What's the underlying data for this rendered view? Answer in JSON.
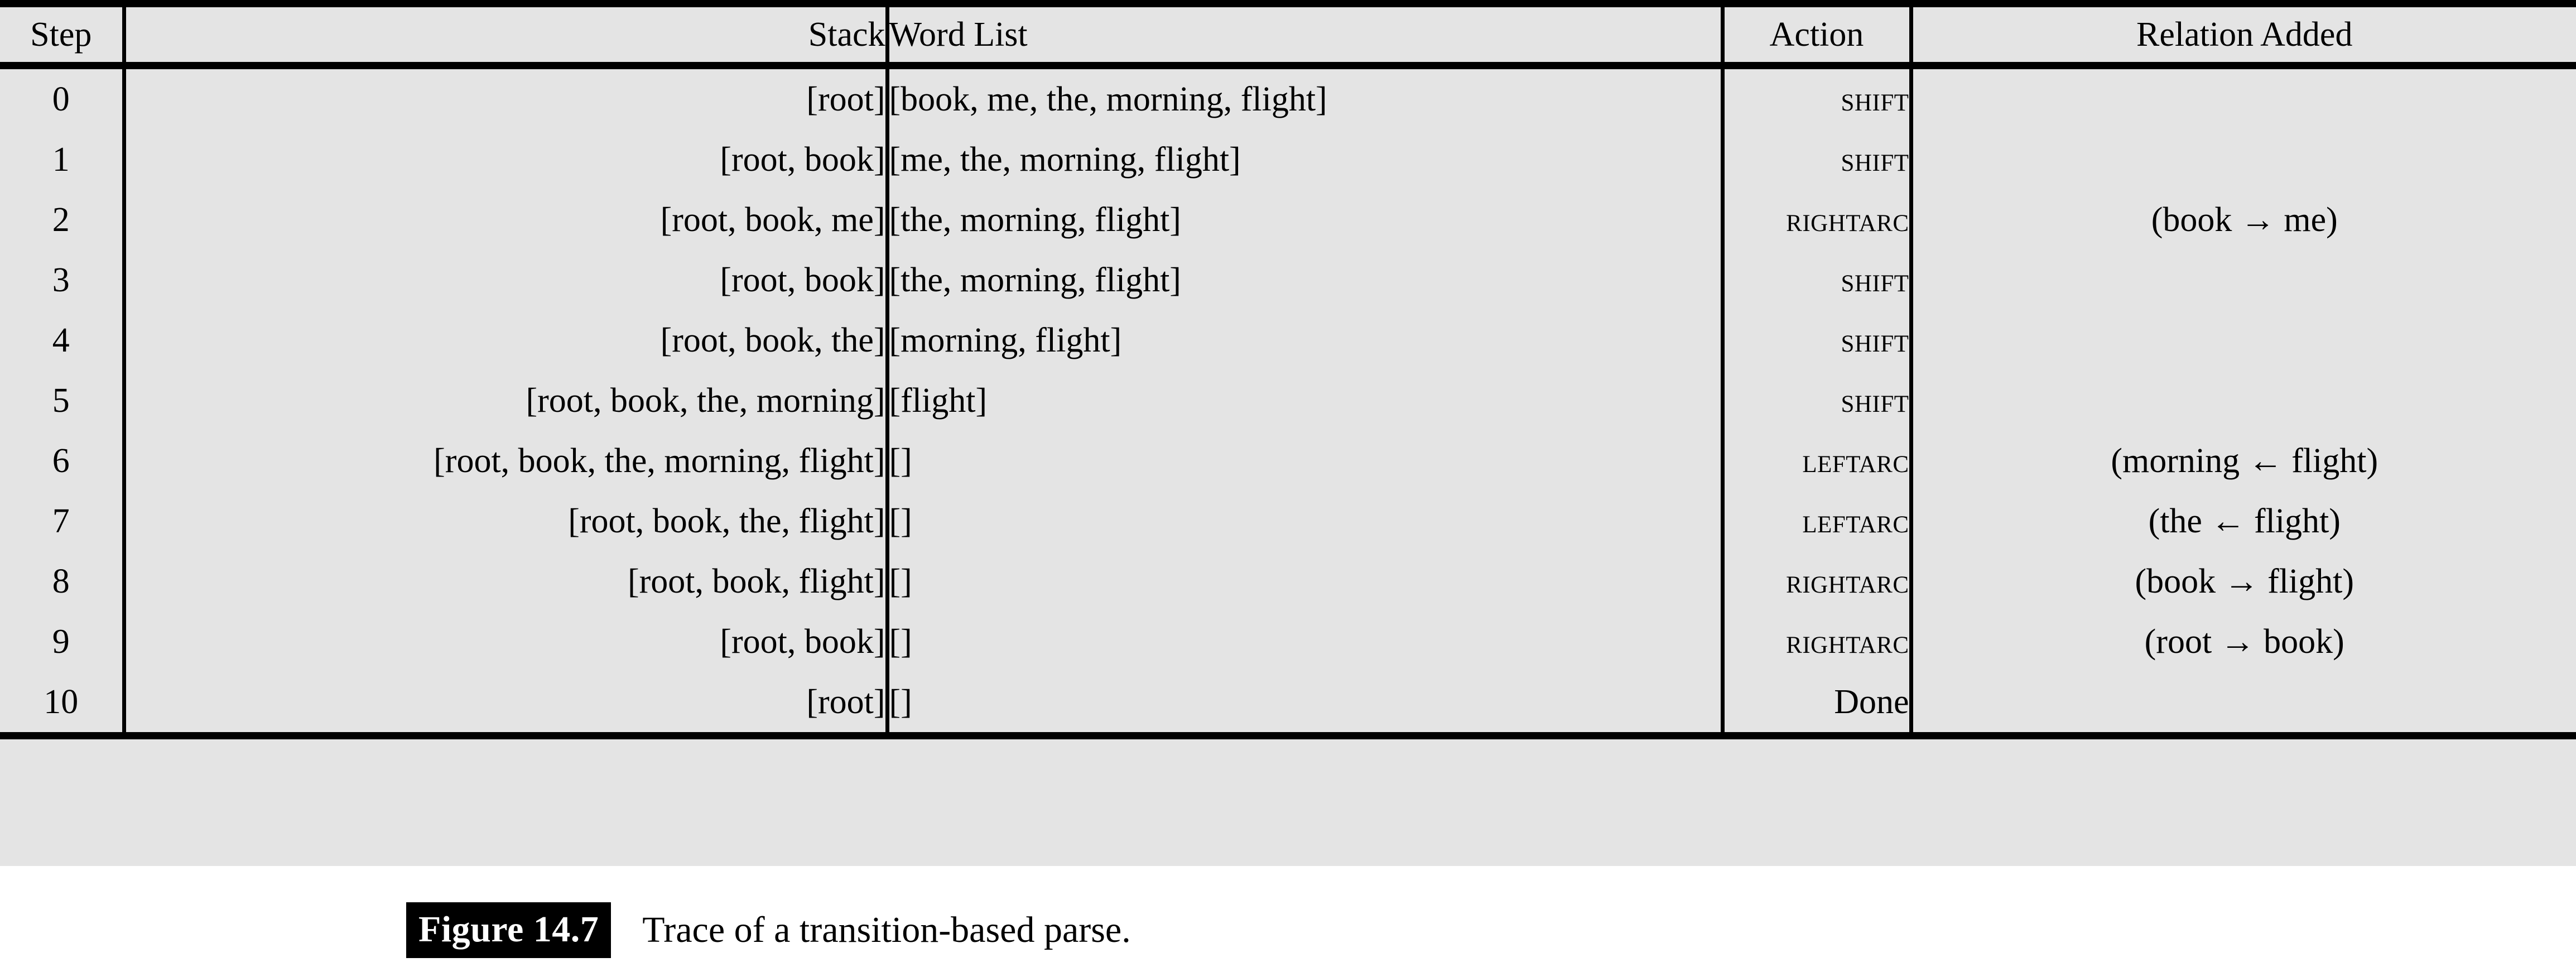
{
  "table": {
    "columns": [
      "Step",
      "Stack",
      "Word List",
      "Action",
      "Relation Added"
    ],
    "rows": [
      {
        "step": "0",
        "stack": "[root]",
        "words": "[book, me, the, morning, flight]",
        "action": "SHIFT",
        "relation": ""
      },
      {
        "step": "1",
        "stack": "[root, book]",
        "words": "[me, the, morning, flight]",
        "action": "SHIFT",
        "relation": ""
      },
      {
        "step": "2",
        "stack": "[root, book, me]",
        "words": "[the, morning, flight]",
        "action": "RIGHTARC",
        "relation": "(book → me)"
      },
      {
        "step": "3",
        "stack": "[root, book]",
        "words": "[the, morning, flight]",
        "action": "SHIFT",
        "relation": ""
      },
      {
        "step": "4",
        "stack": "[root, book, the]",
        "words": "[morning, flight]",
        "action": "SHIFT",
        "relation": ""
      },
      {
        "step": "5",
        "stack": "[root, book, the, morning]",
        "words": "[flight]",
        "action": "SHIFT",
        "relation": ""
      },
      {
        "step": "6",
        "stack": "[root, book, the, morning, flight]",
        "words": "[]",
        "action": "LEFTARC",
        "relation": "(morning ← flight)"
      },
      {
        "step": "7",
        "stack": "[root, book, the, flight]",
        "words": "[]",
        "action": "LEFTARC",
        "relation": "(the ← flight)"
      },
      {
        "step": "8",
        "stack": "[root, book, flight]",
        "words": "[]",
        "action": "RIGHTARC",
        "relation": "(book → flight)"
      },
      {
        "step": "9",
        "stack": "[root, book]",
        "words": "[]",
        "action": "RIGHTARC",
        "relation": "(root → book)"
      },
      {
        "step": "10",
        "stack": "[root]",
        "words": "[]",
        "action": "Done",
        "relation": ""
      }
    ]
  },
  "caption": {
    "figure_label": "Figure 14.7",
    "figure_text": "Trace of a transition-based parse."
  },
  "colors": {
    "table_background": "#e4e4e4",
    "rule": "#000000",
    "page_background": "#ffffff",
    "caption_tag_background": "#000000",
    "caption_tag_text": "#ffffff"
  }
}
